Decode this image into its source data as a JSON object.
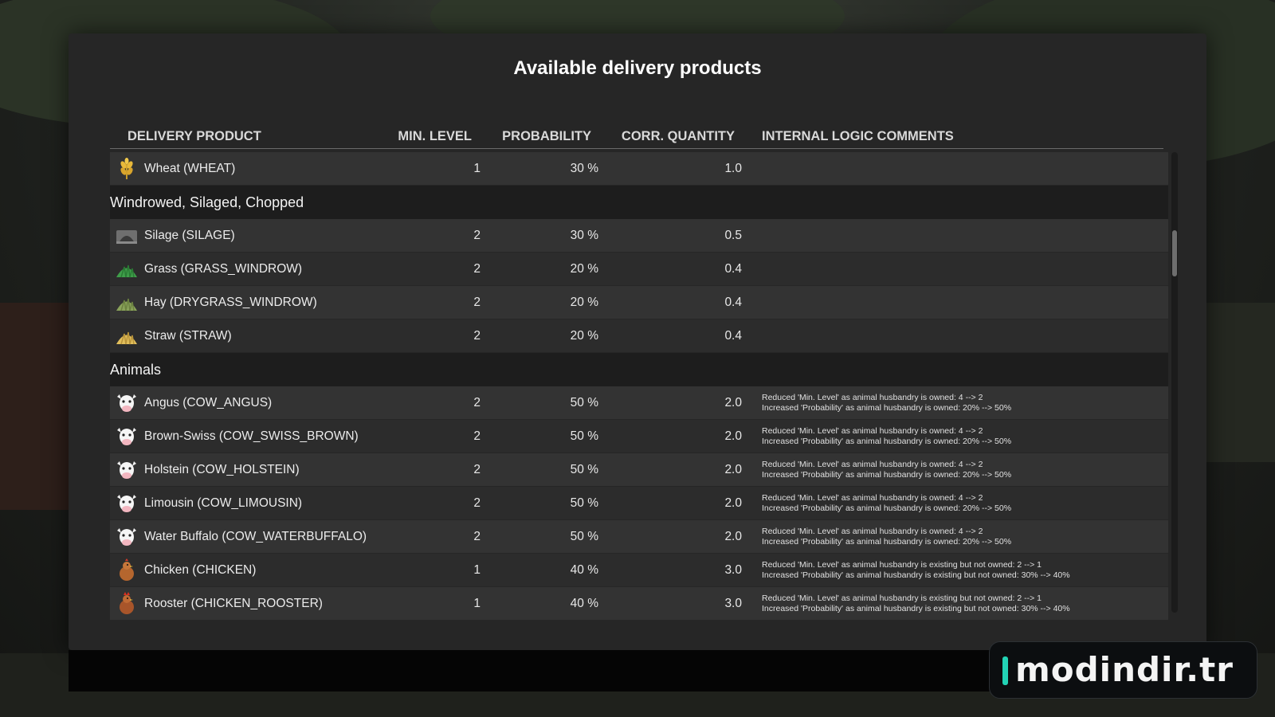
{
  "dialog": {
    "title": "Available delivery products"
  },
  "columns": {
    "product": "DELIVERY PRODUCT",
    "min_level": "MIN. LEVEL",
    "probability": "PROBABILITY",
    "corr_quantity": "CORR. QUANTITY",
    "comments": "INTERNAL LOGIC COMMENTS"
  },
  "rows": [
    {
      "type": "product",
      "icon": "wheat-icon",
      "name": "Wheat (WHEAT)",
      "min_level": "1",
      "probability": "30 %",
      "quantity": "1.0",
      "comment1": "",
      "comment2": ""
    },
    {
      "type": "section",
      "label": "Windrowed, Silaged, Chopped"
    },
    {
      "type": "product",
      "icon": "silage-icon",
      "name": "Silage (SILAGE)",
      "min_level": "2",
      "probability": "30 %",
      "quantity": "0.5",
      "comment1": "",
      "comment2": ""
    },
    {
      "type": "product",
      "icon": "grass-icon",
      "name": "Grass (GRASS_WINDROW)",
      "min_level": "2",
      "probability": "20 %",
      "quantity": "0.4",
      "comment1": "",
      "comment2": ""
    },
    {
      "type": "product",
      "icon": "hay-icon",
      "name": "Hay (DRYGRASS_WINDROW)",
      "min_level": "2",
      "probability": "20 %",
      "quantity": "0.4",
      "comment1": "",
      "comment2": ""
    },
    {
      "type": "product",
      "icon": "straw-icon",
      "name": "Straw (STRAW)",
      "min_level": "2",
      "probability": "20 %",
      "quantity": "0.4",
      "comment1": "",
      "comment2": ""
    },
    {
      "type": "section",
      "label": "Animals"
    },
    {
      "type": "product",
      "icon": "cow-icon",
      "name": "Angus (COW_ANGUS)",
      "min_level": "2",
      "probability": "50 %",
      "quantity": "2.0",
      "comment1": "Reduced 'Min. Level' as animal husbandry is owned: 4 --> 2",
      "comment2": "Increased 'Probability' as animal husbandry is owned: 20% --> 50%"
    },
    {
      "type": "product",
      "icon": "cow-icon",
      "name": "Brown-Swiss (COW_SWISS_BROWN)",
      "min_level": "2",
      "probability": "50 %",
      "quantity": "2.0",
      "comment1": "Reduced 'Min. Level' as animal husbandry is owned: 4 --> 2",
      "comment2": "Increased 'Probability' as animal husbandry is owned: 20% --> 50%"
    },
    {
      "type": "product",
      "icon": "cow-icon",
      "name": "Holstein (COW_HOLSTEIN)",
      "min_level": "2",
      "probability": "50 %",
      "quantity": "2.0",
      "comment1": "Reduced 'Min. Level' as animal husbandry is owned: 4 --> 2",
      "comment2": "Increased 'Probability' as animal husbandry is owned: 20% --> 50%"
    },
    {
      "type": "product",
      "icon": "cow-icon",
      "name": "Limousin (COW_LIMOUSIN)",
      "min_level": "2",
      "probability": "50 %",
      "quantity": "2.0",
      "comment1": "Reduced 'Min. Level' as animal husbandry is owned: 4 --> 2",
      "comment2": "Increased 'Probability' as animal husbandry is owned: 20% --> 50%"
    },
    {
      "type": "product",
      "icon": "cow-icon",
      "name": "Water Buffalo (COW_WATERBUFFALO)",
      "min_level": "2",
      "probability": "50 %",
      "quantity": "2.0",
      "comment1": "Reduced 'Min. Level' as animal husbandry is owned: 4 --> 2",
      "comment2": "Increased 'Probability' as animal husbandry is owned: 20% --> 50%"
    },
    {
      "type": "product",
      "icon": "chicken-icon",
      "name": "Chicken (CHICKEN)",
      "min_level": "1",
      "probability": "40 %",
      "quantity": "3.0",
      "comment1": "Reduced 'Min. Level' as animal husbandry is existing but not owned: 2 --> 1",
      "comment2": "Increased 'Probability' as animal husbandry is existing but not owned: 30% --> 40%"
    },
    {
      "type": "product",
      "icon": "rooster-icon",
      "name": "Rooster (CHICKEN_ROOSTER)",
      "min_level": "1",
      "probability": "40 %",
      "quantity": "3.0",
      "comment1": "Reduced 'Min. Level' as animal husbandry is existing but not owned: 2 --> 1",
      "comment2": "Increased 'Probability' as animal husbandry is existing but not owned: 30% --> 40%"
    }
  ],
  "watermark": {
    "text": "modindir.tr",
    "accent_color": "#22d3b5"
  },
  "colors": {
    "panel": "#262626",
    "row": "#333333",
    "row_alt": "#2c2c2c",
    "section": "#1d1d1d"
  }
}
